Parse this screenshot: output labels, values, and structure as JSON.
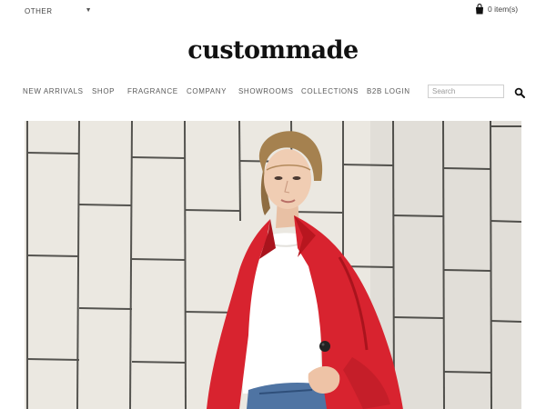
{
  "header": {
    "region_label": "OTHER",
    "cart_label": "0 item(s)",
    "logo": "custommade"
  },
  "nav": {
    "items": [
      "NEW ARRIVALS",
      "SHOP",
      "FRAGRANCE",
      "COMPANY",
      "SHOWROOMS",
      "COLLECTIONS",
      "B2B LOGIN"
    ]
  },
  "search": {
    "placeholder": "Search"
  },
  "icons": {
    "region": "chevron-down-icon",
    "cart": "shopping-bag-icon",
    "search": "search-icon"
  },
  "colors": {
    "coat": "#d8232f",
    "wall": "#ece9e2",
    "logo": "#111111"
  }
}
